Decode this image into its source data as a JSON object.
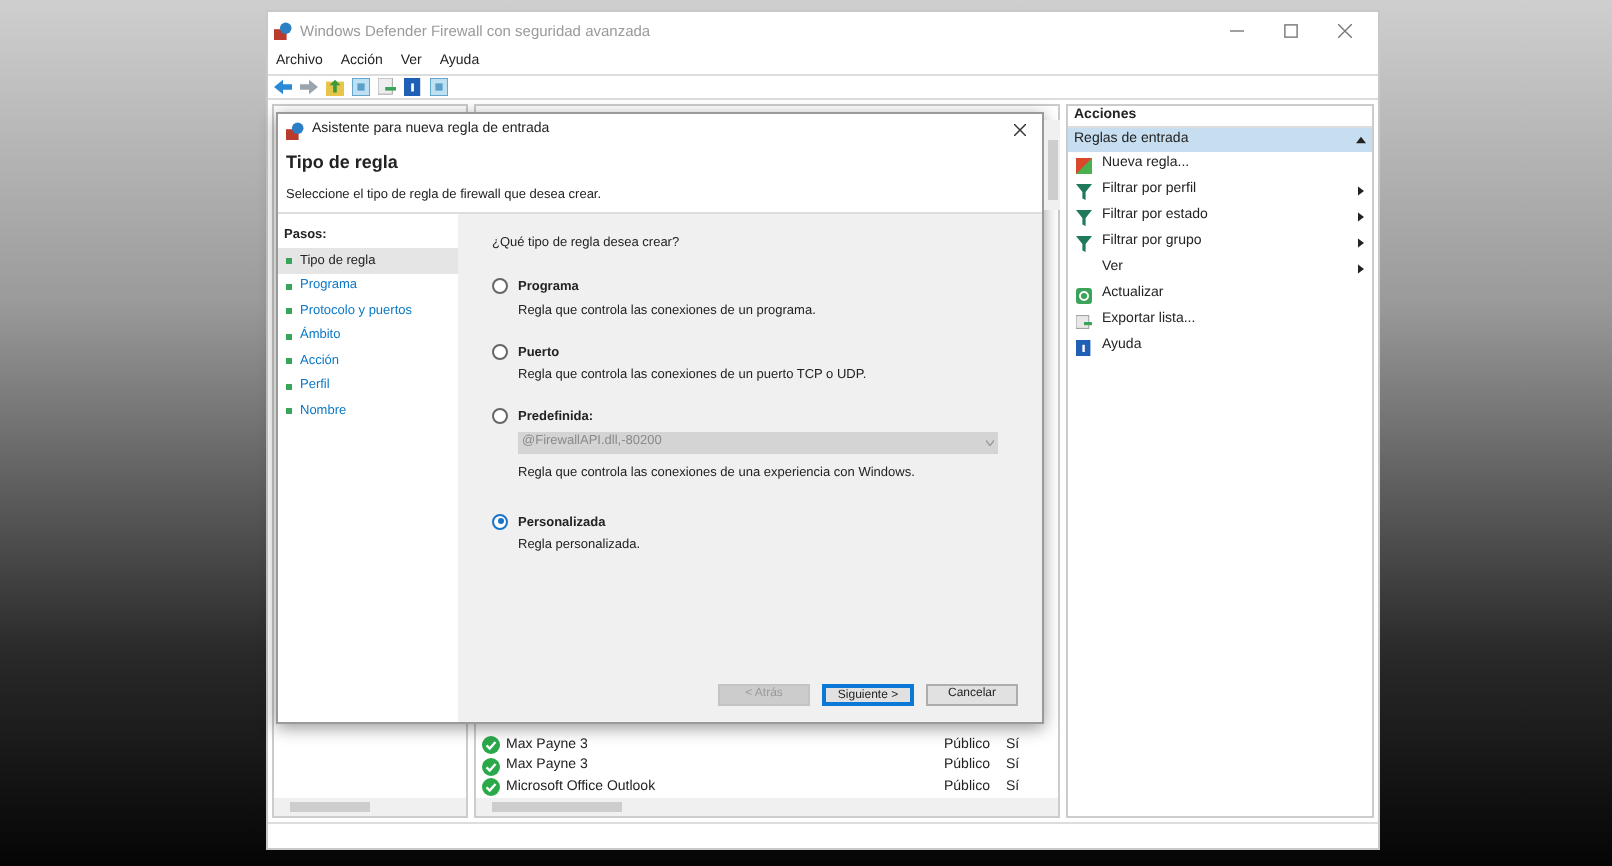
{
  "window": {
    "title": "Windows Defender Firewall con seguridad avanzada"
  },
  "menu": [
    "Archivo",
    "Acción",
    "Ver",
    "Ayuda"
  ],
  "rules_list": {
    "rows": [
      {
        "name": "Max Payne 3",
        "profile": "Público",
        "enabled": "Sí"
      },
      {
        "name": "Max Payne 3",
        "profile": "Público",
        "enabled": "Sí"
      },
      {
        "name": "Microsoft Office Outlook",
        "profile": "Público",
        "enabled": "Sí"
      }
    ]
  },
  "actions": {
    "title": "Acciones",
    "section": {
      "title": "Reglas de entrada",
      "expanded": true
    },
    "items": [
      {
        "label": "Nueva regla...",
        "kind": "new",
        "submenu": false
      },
      {
        "label": "Filtrar por perfil",
        "kind": "filter",
        "submenu": true
      },
      {
        "label": "Filtrar por estado",
        "kind": "filter",
        "submenu": true
      },
      {
        "label": "Filtrar por grupo",
        "kind": "filter",
        "submenu": true
      },
      {
        "label": "Ver",
        "kind": "none",
        "submenu": true
      },
      {
        "label": "Actualizar",
        "kind": "refresh",
        "submenu": false
      },
      {
        "label": "Exportar lista...",
        "kind": "export",
        "submenu": false
      },
      {
        "label": "Ayuda",
        "kind": "help",
        "submenu": false
      }
    ]
  },
  "dialog": {
    "title": "Asistente para nueva regla de entrada",
    "heading": "Tipo de regla",
    "subheading": "Seleccione el tipo de regla de firewall que desea crear.",
    "steps_title": "Pasos:",
    "steps": [
      {
        "label": "Tipo de regla",
        "selected": true
      },
      {
        "label": "Programa",
        "selected": false
      },
      {
        "label": "Protocolo y puertos",
        "selected": false
      },
      {
        "label": "Ámbito",
        "selected": false
      },
      {
        "label": "Acción",
        "selected": false
      },
      {
        "label": "Perfil",
        "selected": false
      },
      {
        "label": "Nombre",
        "selected": false
      }
    ],
    "question": "¿Qué tipo de regla desea crear?",
    "options": [
      {
        "kind": "plain",
        "title": "Programa",
        "description": "Regla que controla las conexiones de un programa.",
        "selected": false
      },
      {
        "kind": "plain",
        "title": "Puerto",
        "description": "Regla que controla las conexiones de un puerto TCP o UDP.",
        "selected": false
      },
      {
        "kind": "select",
        "title": "Predefinida:",
        "select_value": "@FirewallAPI.dll,-80200",
        "description": "Regla que controla las conexiones de una experiencia con Windows.",
        "selected": false
      },
      {
        "kind": "plain",
        "title": "Personalizada",
        "description": "Regla personalizada.",
        "selected": true
      }
    ],
    "buttons": [
      {
        "label": "< Atrás",
        "disabled": true,
        "default": false
      },
      {
        "label": "Siguiente >",
        "disabled": false,
        "default": true
      },
      {
        "label": "Cancelar",
        "disabled": false,
        "default": false
      }
    ]
  }
}
